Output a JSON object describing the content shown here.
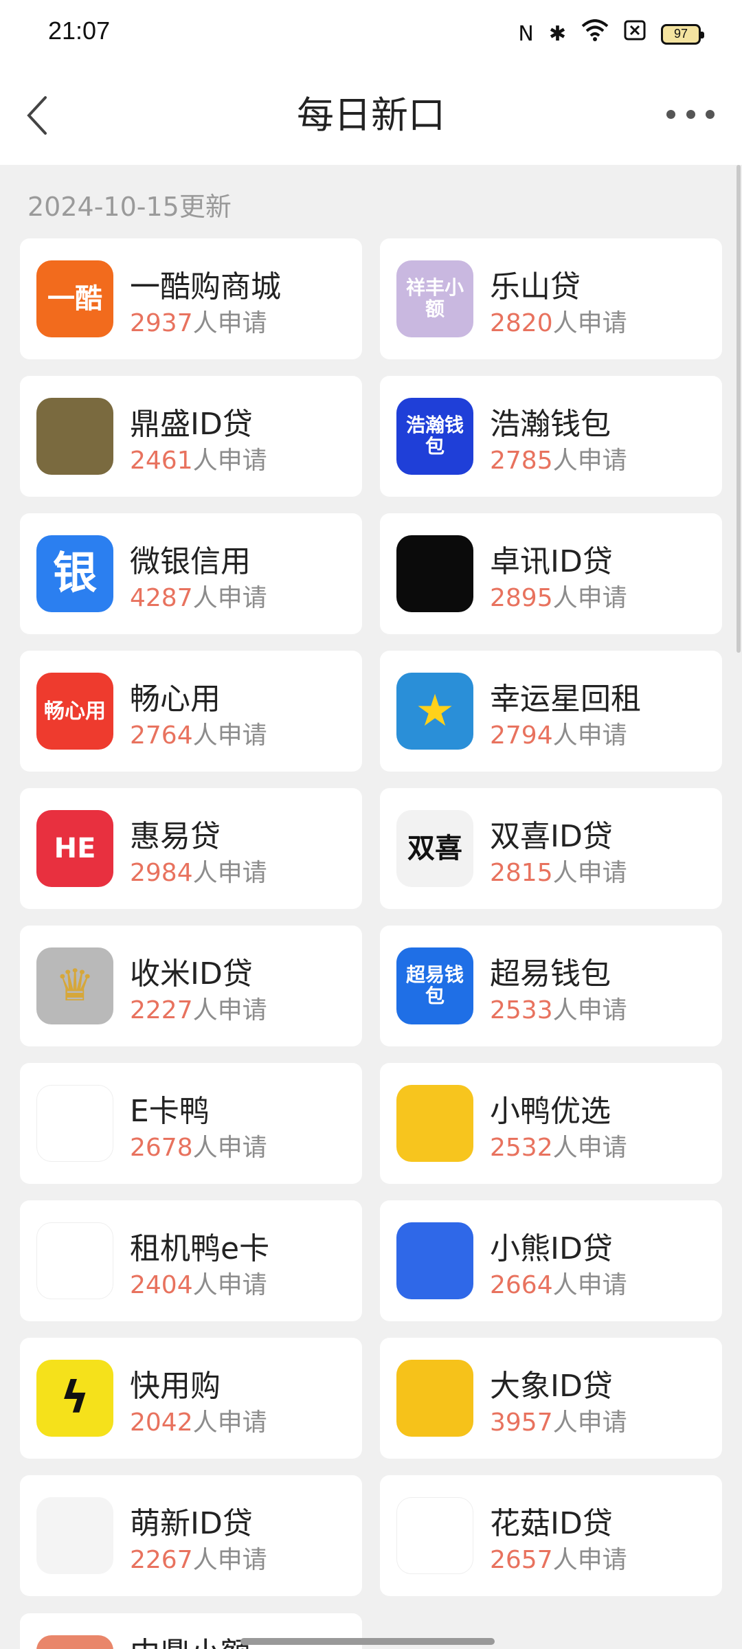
{
  "status_bar": {
    "time": "21:07",
    "icons": [
      "nfc-icon",
      "bluetooth-icon",
      "wifi-icon",
      "sim-off-icon"
    ],
    "battery": "97"
  },
  "nav": {
    "title": "每日新口"
  },
  "update_date": "2024-10-15更新",
  "apply_suffix": "人申请",
  "apps": [
    {
      "name": "一酷购商城",
      "count": "2937",
      "icon_text": "一酷",
      "bg": "#f26b1d",
      "fg": "#ffffff"
    },
    {
      "name": "乐山贷",
      "count": "2820",
      "icon_text": "祥丰小额",
      "bg": "#c9b8e0",
      "fg": "#ffffff"
    },
    {
      "name": "鼎盛ID贷",
      "count": "2461",
      "icon_text": "",
      "bg": "#7a6a3f",
      "fg": "#ffffff"
    },
    {
      "name": "浩瀚钱包",
      "count": "2785",
      "icon_text": "浩瀚钱包",
      "bg": "#1f3fd8",
      "fg": "#ffffff"
    },
    {
      "name": "微银信用",
      "count": "4287",
      "icon_text": "银",
      "bg": "#2b7ff0",
      "fg": "#ffffff"
    },
    {
      "name": "卓讯ID贷",
      "count": "2895",
      "icon_text": "",
      "bg": "#0b0b0b",
      "fg": "#ffffff"
    },
    {
      "name": "畅心用",
      "count": "2764",
      "icon_text": "畅心用",
      "bg": "#ee3b2e",
      "fg": "#ffffff"
    },
    {
      "name": "幸运星回租",
      "count": "2794",
      "icon_text": "★",
      "bg": "#2a8fd8",
      "fg": "#ffd11a"
    },
    {
      "name": "惠易贷",
      "count": "2984",
      "icon_text": "HE",
      "bg": "#e8303f",
      "fg": "#ffffff"
    },
    {
      "name": "双喜ID贷",
      "count": "2815",
      "icon_text": "双喜",
      "bg": "#f2f2f2",
      "fg": "#111111"
    },
    {
      "name": "收米ID贷",
      "count": "2227",
      "icon_text": "♛",
      "bg": "#b9b9b9",
      "fg": "#d6a73a"
    },
    {
      "name": "超易钱包",
      "count": "2533",
      "icon_text": "超易钱包",
      "bg": "#1f6fe6",
      "fg": "#ffffff"
    },
    {
      "name": "E卡鸭",
      "count": "2678",
      "icon_text": "",
      "bg": "#ffffff",
      "fg": "#f2c21b"
    },
    {
      "name": "小鸭优选",
      "count": "2532",
      "icon_text": "",
      "bg": "#f7c51e",
      "fg": "#222222"
    },
    {
      "name": "租机鸭e卡",
      "count": "2404",
      "icon_text": "",
      "bg": "#ffffff",
      "fg": "#f2c21b"
    },
    {
      "name": "小熊ID贷",
      "count": "2664",
      "icon_text": "",
      "bg": "#2f68e8",
      "fg": "#ffffff"
    },
    {
      "name": "快用购",
      "count": "2042",
      "icon_text": "ϟ",
      "bg": "#f5e11b",
      "fg": "#111111"
    },
    {
      "name": "大象ID贷",
      "count": "3957",
      "icon_text": "",
      "bg": "#f6c21a",
      "fg": "#f08a1c"
    },
    {
      "name": "萌新ID贷",
      "count": "2267",
      "icon_text": "",
      "bg": "#f4f4f4",
      "fg": "#8bbd3f"
    },
    {
      "name": "花菇ID贷",
      "count": "2657",
      "icon_text": "",
      "bg": "#ffffff",
      "fg": "#d93a2e"
    }
  ],
  "partial_item": {
    "name": "中鼎小额"
  }
}
